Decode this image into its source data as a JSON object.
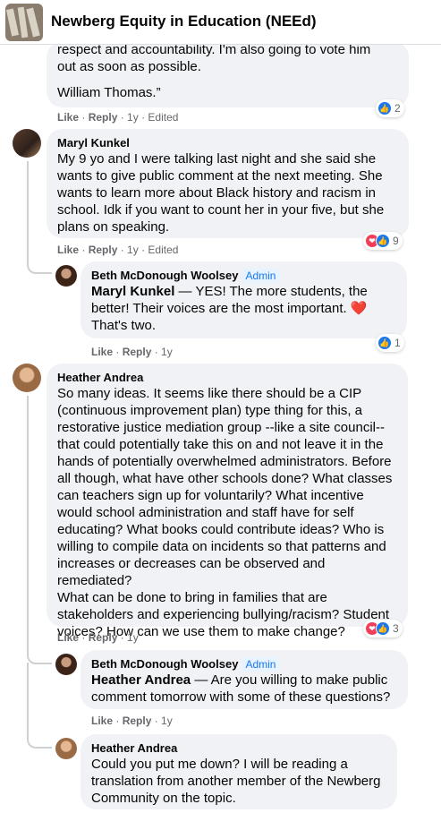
{
  "group": {
    "title": "Newberg Equity in Education (NEEd)"
  },
  "comments": [
    {
      "lines": [
        "respect and accountability. I'm also going to vote him",
        "out as soon as possible.",
        "",
        "William Thomas.”"
      ],
      "actions": {
        "like": "Like",
        "reply": "Reply",
        "time": "1y",
        "edited": "Edited"
      },
      "reaction_count": "2"
    },
    {
      "author": "Maryl Kunkel",
      "lines": [
        "My 9 yo and I were talking last night and she said she",
        "wants to give public comment at the next meeting. She",
        "wants to learn more about Black history and racism in",
        "school. Idk if you want to count her in your five, but she",
        "plans on speaking."
      ],
      "actions": {
        "like": "Like",
        "reply": "Reply",
        "time": "1y",
        "edited": "Edited"
      },
      "reaction_count": "9"
    },
    {
      "author": "Beth McDonough Woolsey",
      "badge": "Admin",
      "mention": "Maryl Kunkel",
      "first_line": " — YES! The more students, the",
      "lines": [
        "better! Their voices are the most important. ❤️",
        "That's two."
      ],
      "actions": {
        "like": "Like",
        "reply": "Reply",
        "time": "1y"
      },
      "reaction_count": "1"
    },
    {
      "author": "Heather Andrea",
      "lines": [
        "So many ideas. It seems like there should be a CIP",
        "(continuous improvement plan) type thing for this, a",
        "restorative justice mediation group --like a site council--",
        "that could potentially take this on and not leave it in the",
        "hands of potentially overwhelmed administrators. Before",
        "all though, what have other schools done? What classes",
        "can teachers sign up for voluntarily? What incentive",
        "would school administration and staff have for self",
        "educating? What books could contribute ideas? Who is",
        "willing to compile data on incidents so that patterns and",
        "increases or decreases can be observed and remediated?",
        "What can be done to bring in families that are",
        "stakeholders and experiencing bullying/racism? Student",
        "voices? How can we use them to make change?"
      ],
      "actions": {
        "like": "Like",
        "reply": "Reply",
        "time": "1y"
      },
      "reaction_count": "3"
    },
    {
      "author": "Beth McDonough Woolsey",
      "badge": "Admin",
      "mention": "Heather Andrea",
      "first_line": " — Are you willing to make public",
      "lines": [
        "comment tomorrow with some of these questions?"
      ],
      "actions": {
        "like": "Like",
        "reply": "Reply",
        "time": "1y"
      }
    },
    {
      "author": "Heather Andrea",
      "lines": [
        "Could you put me down? I will be reading a",
        "translation from another member of the Newberg",
        "Community on the topic."
      ]
    }
  ],
  "meta_separator": " · ",
  "icons": {
    "like": "thumbs-up-icon",
    "love": "heart-icon"
  },
  "colors": {
    "like": "#1877f2",
    "love": "#f33e58",
    "admin_badge": "#1877f2",
    "bubble": "#f0f2f5"
  }
}
